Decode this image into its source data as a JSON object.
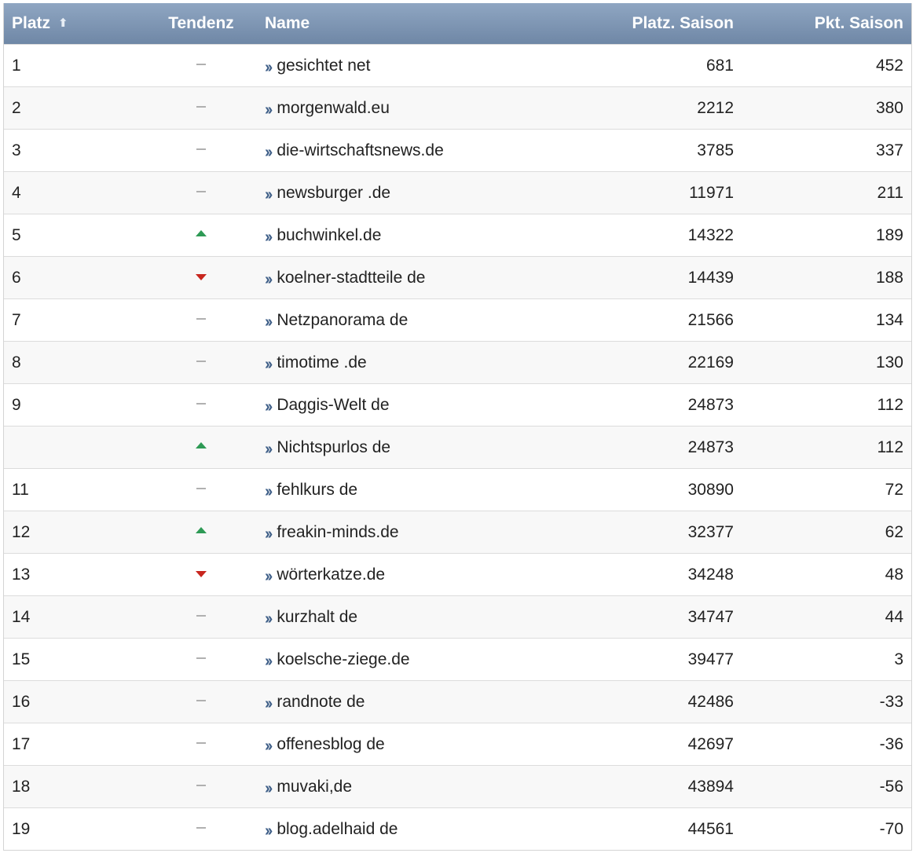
{
  "header": {
    "platz": "Platz",
    "sort_icon": "arrow-up-icon",
    "tendenz": "Tendenz",
    "name": "Name",
    "platz_saison": "Platz. Saison",
    "pkt_saison": "Pkt. Saison"
  },
  "colors": {
    "header_top": "#8fa6c2",
    "header_bottom": "#6f87a6",
    "trend_up": "#2e9a55",
    "trend_down": "#c8261e",
    "trend_flat": "#b0b0b0",
    "chevron": "#3f5f88"
  },
  "rows": [
    {
      "platz": "1",
      "trend": "flat",
      "name": "gesichtet net",
      "platz_saison": "681",
      "pkt_saison": "452"
    },
    {
      "platz": "2",
      "trend": "flat",
      "name": "morgenwald.eu",
      "platz_saison": "2212",
      "pkt_saison": "380"
    },
    {
      "platz": "3",
      "trend": "flat",
      "name": "die-wirtschaftsnews.de",
      "platz_saison": "3785",
      "pkt_saison": "337"
    },
    {
      "platz": "4",
      "trend": "flat",
      "name": "newsburger .de",
      "platz_saison": "11971",
      "pkt_saison": "211"
    },
    {
      "platz": "5",
      "trend": "up",
      "name": "buchwinkel.de",
      "platz_saison": "14322",
      "pkt_saison": "189"
    },
    {
      "platz": "6",
      "trend": "down",
      "name": "koelner-stadtteile de",
      "platz_saison": "14439",
      "pkt_saison": "188"
    },
    {
      "platz": "7",
      "trend": "flat",
      "name": "Netzpanorama de",
      "platz_saison": "21566",
      "pkt_saison": "134"
    },
    {
      "platz": "8",
      "trend": "flat",
      "name": "timotime .de",
      "platz_saison": "22169",
      "pkt_saison": "130"
    },
    {
      "platz": "9",
      "trend": "flat",
      "name": "Daggis-Welt de",
      "platz_saison": "24873",
      "pkt_saison": "112"
    },
    {
      "platz": "",
      "trend": "up",
      "name": "Nichtspurlos de",
      "platz_saison": "24873",
      "pkt_saison": "112"
    },
    {
      "platz": "11",
      "trend": "flat",
      "name": "fehlkurs de",
      "platz_saison": "30890",
      "pkt_saison": "72"
    },
    {
      "platz": "12",
      "trend": "up",
      "name": "freakin-minds.de",
      "platz_saison": "32377",
      "pkt_saison": "62"
    },
    {
      "platz": "13",
      "trend": "down",
      "name": "wörterkatze.de",
      "platz_saison": "34248",
      "pkt_saison": "48"
    },
    {
      "platz": "14",
      "trend": "flat",
      "name": "kurzhalt de",
      "platz_saison": "34747",
      "pkt_saison": "44"
    },
    {
      "platz": "15",
      "trend": "flat",
      "name": "koelsche-ziege.de",
      "platz_saison": "39477",
      "pkt_saison": "3"
    },
    {
      "platz": "16",
      "trend": "flat",
      "name": "randnote de",
      "platz_saison": "42486",
      "pkt_saison": "-33"
    },
    {
      "platz": "17",
      "trend": "flat",
      "name": "offenesblog de",
      "platz_saison": "42697",
      "pkt_saison": "-36"
    },
    {
      "platz": "18",
      "trend": "flat",
      "name": "muvaki,de",
      "platz_saison": "43894",
      "pkt_saison": "-56"
    },
    {
      "platz": "19",
      "trend": "flat",
      "name": "blog.adelhaid de",
      "platz_saison": "44561",
      "pkt_saison": "-70"
    }
  ]
}
